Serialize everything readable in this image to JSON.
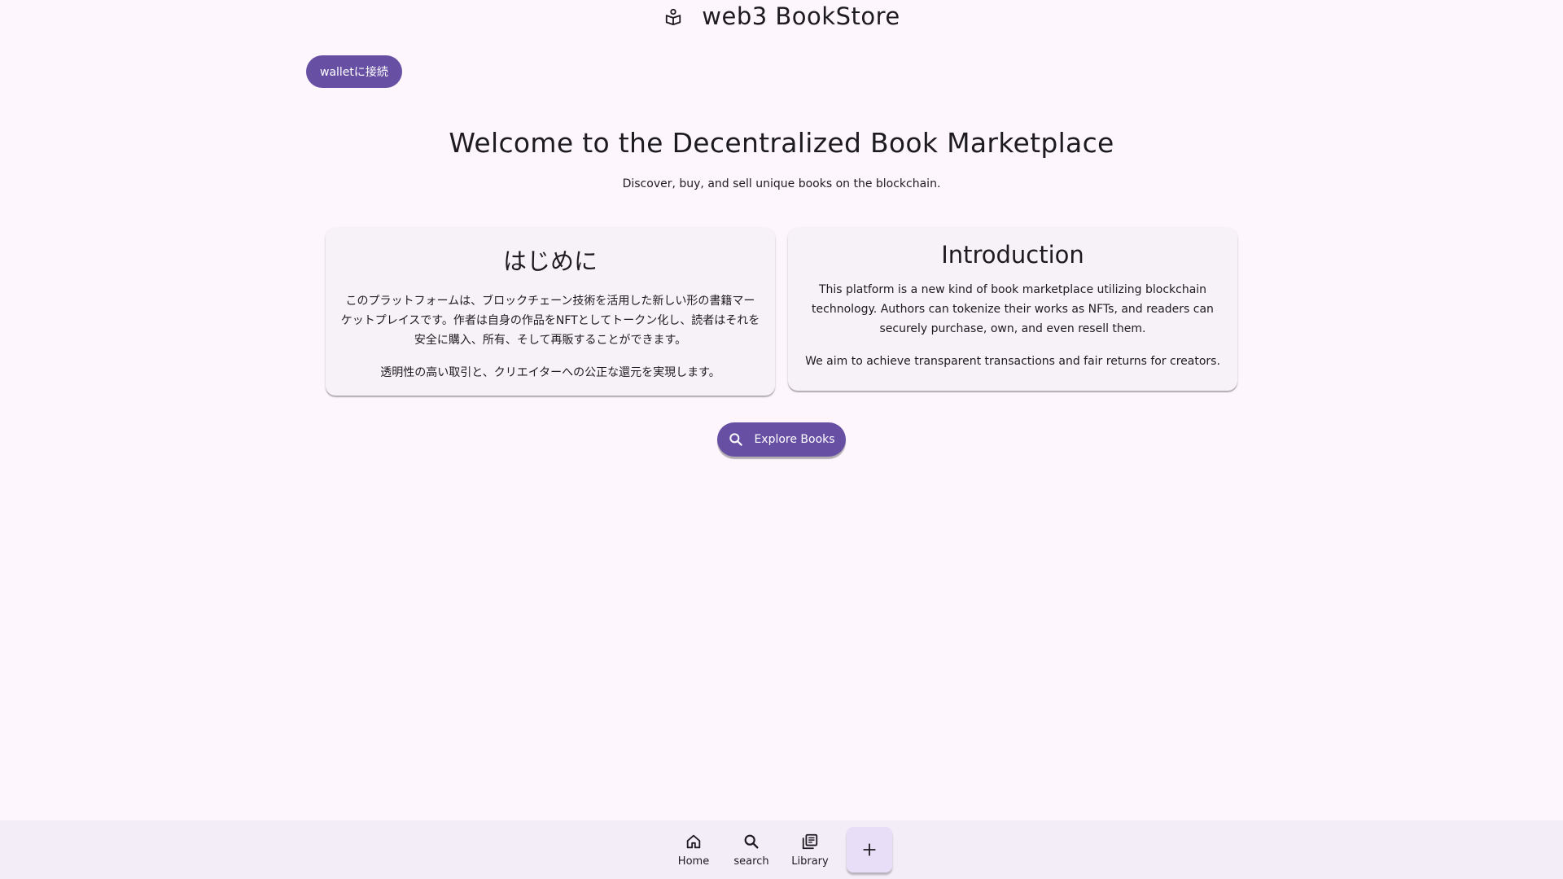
{
  "header": {
    "title": "web3 BookStore",
    "icon": "book-reader-icon"
  },
  "wallet": {
    "label": "walletに接続"
  },
  "hero": {
    "title": "Welcome to the Decentralized Book Marketplace",
    "subtitle": "Discover, buy, and sell unique books on the blockchain."
  },
  "cards": {
    "jp": {
      "title": "はじめに",
      "p1": "このプラットフォームは、ブロックチェーン技術を活用した新しい形の書籍マーケットプレイスです。作者は自身の作品をNFTとしてトークン化し、読者はそれを安全に購入、所有、そして再販することができます。",
      "p2": "透明性の高い取引と、クリエイターへの公正な還元を実現します。"
    },
    "en": {
      "title": "Introduction",
      "p1": "This platform is a new kind of book marketplace utilizing blockchain technology. Authors can tokenize their works as NFTs, and readers can securely purchase, own, and even resell them.",
      "p2": "We aim to achieve transparent transactions and fair returns for creators."
    }
  },
  "explore": {
    "label": "Explore Books",
    "icon": "search-icon"
  },
  "bottom_nav": {
    "items": [
      {
        "label": "Home",
        "icon": "home-icon"
      },
      {
        "label": "search",
        "icon": "search-icon"
      },
      {
        "label": "Library",
        "icon": "library-icon"
      }
    ],
    "fab_icon": "plus-icon"
  },
  "colors": {
    "primary": "#6750a4",
    "background": "#fdf7fd",
    "card": "#f7f2f7",
    "nav": "#f3edf7",
    "fab": "#e8def8"
  }
}
